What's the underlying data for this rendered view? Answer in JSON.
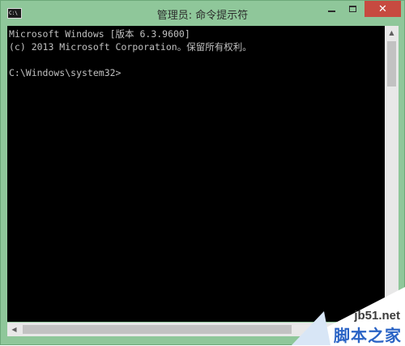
{
  "window": {
    "title": "管理员: 命令提示符",
    "icon_text": "C:\\",
    "controls": {
      "minimize": "minimize-icon",
      "maximize": "maximize-icon",
      "close": "✕"
    }
  },
  "console": {
    "lines": [
      "Microsoft Windows [版本 6.3.9600]",
      "(c) 2013 Microsoft Corporation。保留所有权利。",
      "",
      "C:\\Windows\\system32>"
    ]
  },
  "scrollbars": {
    "up_arrow": "▲",
    "down_arrow": "▼",
    "left_arrow": "◀",
    "right_arrow": "▶"
  },
  "watermark": {
    "url": "jb51.net",
    "name": "脚本之家"
  },
  "colors": {
    "frame": "#8fc79a",
    "console_bg": "#000000",
    "console_text": "#c0c0c0",
    "close_button": "#c74a40",
    "watermark_blue": "#2a63c5"
  }
}
